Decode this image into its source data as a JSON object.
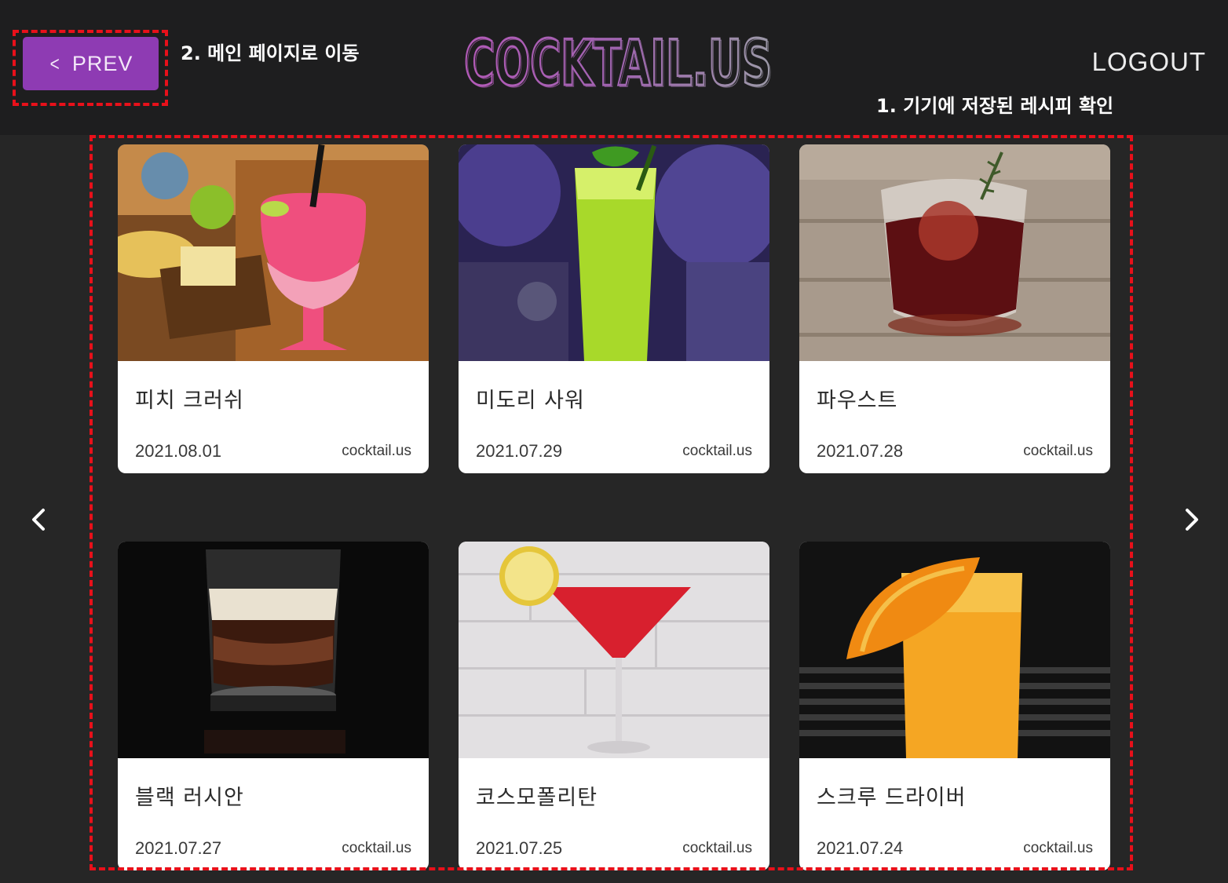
{
  "header": {
    "prev_label": "PREV",
    "logo_text": "COCKTAIL.US",
    "logout_label": "LOGOUT",
    "accent_color": "#8e3bb3"
  },
  "annotations": {
    "prev_note": "2. 메인 페이지로 이동",
    "grid_note": "1. 기기에 저장된 레시피 확인",
    "highlight_color": "#e8101a"
  },
  "navigation": {
    "left_icon": "chevron-left-icon",
    "right_icon": "chevron-right-icon"
  },
  "recipes": [
    {
      "title": "피치 크러쉬",
      "date": "2021.08.01",
      "site": "cocktail.us"
    },
    {
      "title": "미도리 사워",
      "date": "2021.07.29",
      "site": "cocktail.us"
    },
    {
      "title": "파우스트",
      "date": "2021.07.28",
      "site": "cocktail.us"
    },
    {
      "title": "블랙 러시안",
      "date": "2021.07.27",
      "site": "cocktail.us"
    },
    {
      "title": "코스모폴리탄",
      "date": "2021.07.25",
      "site": "cocktail.us"
    },
    {
      "title": "스크루 드라이버",
      "date": "2021.07.24",
      "site": "cocktail.us"
    }
  ]
}
